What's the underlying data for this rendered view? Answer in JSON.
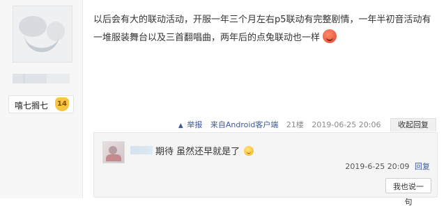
{
  "user": {
    "name": "嘻七搁七",
    "level": "14"
  },
  "post": {
    "content": "以后会有大的联动活动，开服一年三个月左右p5联动有完整剧情，一年半初音活动有一堆服装舞台以及三首翻唱曲，两年后的点兔联动也一样",
    "emoji": "face-emoji"
  },
  "meta": {
    "report": "举报",
    "source": "来自Android客户端",
    "floor": "21楼",
    "datetime": "2019-06-25 20:06",
    "collapse": "收起回复"
  },
  "reply": {
    "text": "期待 虽然还早就是了",
    "datetime": "2019-6-25 20:09",
    "reply_label": "回复",
    "say_button": "我也说一句"
  }
}
